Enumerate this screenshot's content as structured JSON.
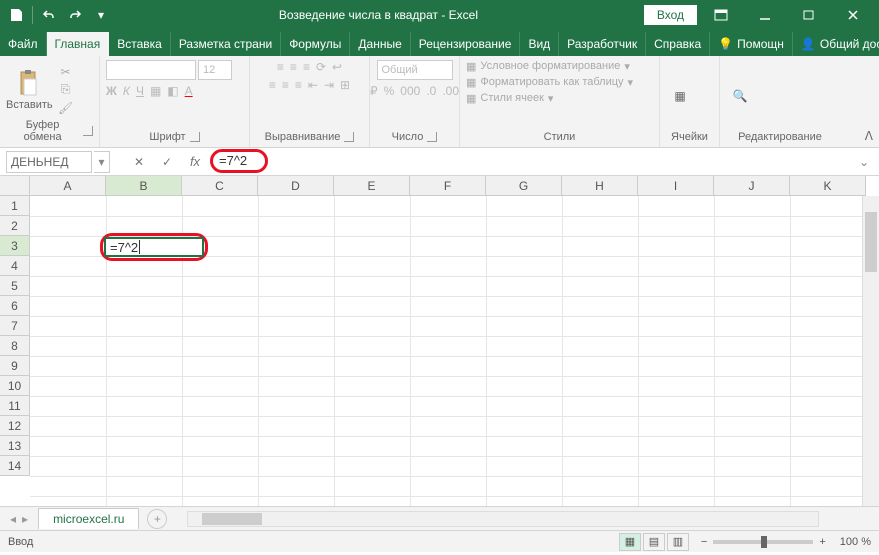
{
  "titlebar": {
    "document_title": "Возведение числа в квадрат",
    "app_suffix": "  -  Excel",
    "login": "Вход"
  },
  "tabs": {
    "file": "Файл",
    "home": "Главная",
    "insert": "Вставка",
    "page_layout": "Разметка страни",
    "formulas": "Формулы",
    "data": "Данные",
    "review": "Рецензирование",
    "view": "Вид",
    "developer": "Разработчик",
    "help": "Справка",
    "tell_me": "Помощн",
    "share": "Общий доступ"
  },
  "ribbon": {
    "clipboard": {
      "label": "Буфер обмена",
      "paste": "Вставить"
    },
    "font": {
      "label": "Шрифт",
      "size": "12"
    },
    "alignment": {
      "label": "Выравнивание"
    },
    "number": {
      "label": "Число",
      "format": "Общий"
    },
    "styles": {
      "label": "Стили",
      "conditional": "Условное форматирование",
      "as_table": "Форматировать как таблицу",
      "cell_styles": "Стили ячеек"
    },
    "cells": {
      "label": "Ячейки"
    },
    "editing": {
      "label": "Редактирование"
    }
  },
  "formula_bar": {
    "name_box": "ДЕНЬНЕД",
    "formula": "=7^2"
  },
  "grid": {
    "columns": [
      "A",
      "B",
      "C",
      "D",
      "E",
      "F",
      "G",
      "H",
      "I",
      "J",
      "K"
    ],
    "rows": [
      "1",
      "2",
      "3",
      "4",
      "5",
      "6",
      "7",
      "8",
      "9",
      "10",
      "11",
      "12",
      "13",
      "14"
    ],
    "active_cell_value": "=7^2"
  },
  "sheet": {
    "name": "microexcel.ru"
  },
  "statusbar": {
    "mode": "Ввод",
    "zoom_minus": "−",
    "zoom_plus": "+",
    "zoom_pct": "100 %"
  }
}
